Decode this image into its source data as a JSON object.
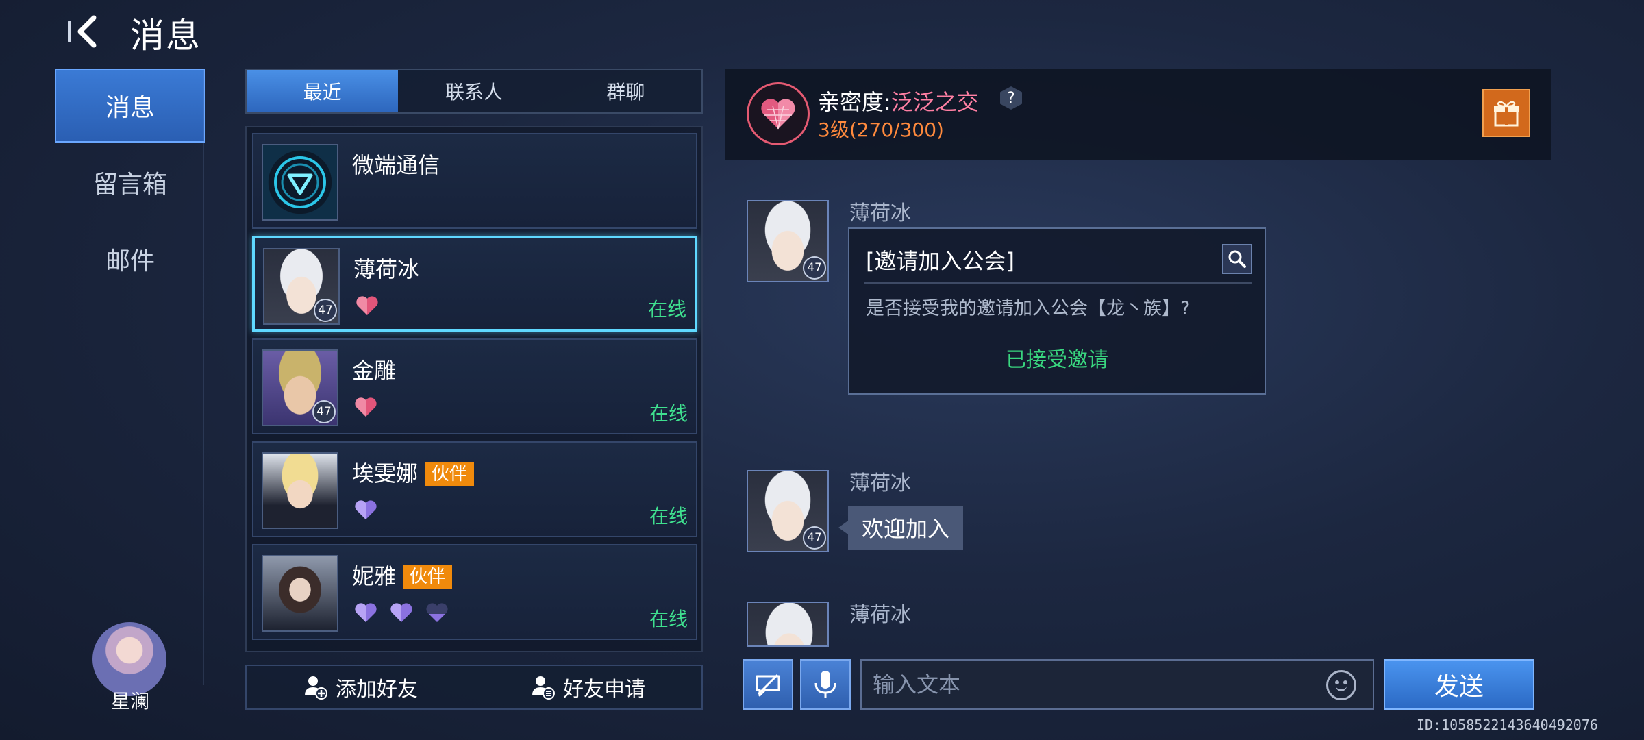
{
  "header": {
    "title": "消息"
  },
  "nav": {
    "items": [
      {
        "label": "消息"
      },
      {
        "label": "留言箱"
      },
      {
        "label": "邮件"
      }
    ]
  },
  "player": {
    "name": "星澜"
  },
  "tabs": [
    {
      "label": "最近"
    },
    {
      "label": "联系人"
    },
    {
      "label": "群聊"
    }
  ],
  "contacts": [
    {
      "name": "微端通信",
      "level": "",
      "tag": "",
      "status": ""
    },
    {
      "name": "薄荷冰",
      "level": "47",
      "tag": "",
      "status": "在线"
    },
    {
      "name": "金雕",
      "level": "47",
      "tag": "",
      "status": "在线"
    },
    {
      "name": "埃雯娜",
      "level": "",
      "tag": "伙伴",
      "status": "在线"
    },
    {
      "name": "妮雅",
      "level": "",
      "tag": "伙伴",
      "status": "在线"
    }
  ],
  "friend_bar": {
    "add_friend": "添加好友",
    "friend_requests": "好友申请"
  },
  "intimacy": {
    "label": "亲密度:",
    "value": "泛泛之交",
    "level": "3级(270/300)"
  },
  "messages": [
    {
      "sender": "薄荷冰",
      "level": "47",
      "card_title": "[邀请加入公会]",
      "card_body": "是否接受我的邀请加入公会【龙丶族】?",
      "card_status": "已接受邀请"
    },
    {
      "sender": "薄荷冰",
      "level": "47",
      "text": "欢迎加入"
    },
    {
      "sender": "薄荷冰"
    }
  ],
  "input": {
    "placeholder": "输入文本",
    "send_label": "发送"
  },
  "user_id": "ID:1058522143640492076",
  "colors": {
    "accent": "#3b7bd6",
    "online": "#3fe08f",
    "tag": "#f08a0c",
    "intimacy": "#ff7fa3"
  }
}
